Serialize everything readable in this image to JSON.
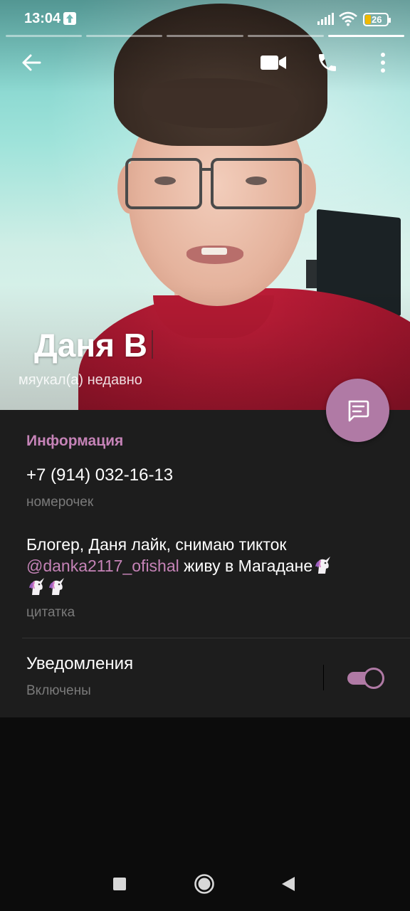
{
  "status_bar": {
    "time": "13:04",
    "battery_percent": "26",
    "icons": [
      "upload-icon",
      "signal-icon",
      "wifi-icon",
      "battery-icon"
    ]
  },
  "header": {
    "name": "Даня В",
    "last_seen": "мяукал(а) недавно",
    "story_segments": {
      "count": 5,
      "active_index": 4
    },
    "actions": [
      "back-arrow-icon",
      "video-call-icon",
      "phone-icon",
      "more-vertical-icon"
    ],
    "fab_icon": "message-icon"
  },
  "info": {
    "section_title": "Информация",
    "phone": "+7 (914) 032-16-13",
    "phone_label": "номерочек",
    "bio_text_1": "Блогер, Даня лайк, снимаю тикток ",
    "bio_handle": "@danka2117_ofishal",
    "bio_text_2": " живу в Магадане",
    "bio_label": "цитатка",
    "emoji": "unicorn-icon"
  },
  "notifications": {
    "title": "Уведомления",
    "status": "Включены",
    "enabled": true
  },
  "colors": {
    "accent": "#c583b7",
    "fab": "#b07aa5",
    "panel_bg": "#1d1d1d",
    "page_bg": "#0c0c0c",
    "secondary_text": "#7a7a7a"
  },
  "nav_bar": [
    "recent-apps-icon",
    "home-icon",
    "back-icon"
  ]
}
